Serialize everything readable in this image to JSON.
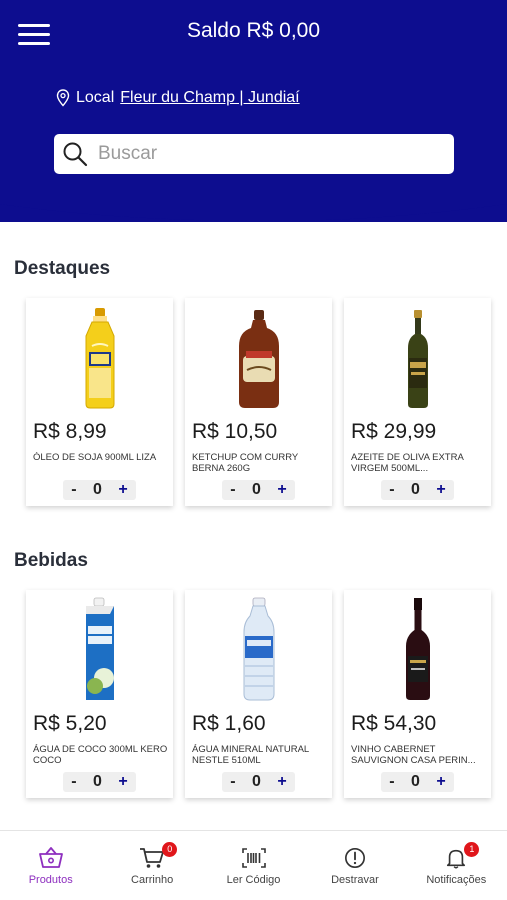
{
  "header": {
    "balance": "Saldo R$ 0,00",
    "location_label": "Local",
    "location_name": "Fleur du Champ | Jundiaí",
    "search_placeholder": "Buscar"
  },
  "sections": [
    {
      "title": "Destaques",
      "products": [
        {
          "price": "R$ 8,99",
          "name": "ÓLEO DE SOJA 900ML LIZA",
          "qty": "0",
          "icon": "oil-bottle-image"
        },
        {
          "price": "R$ 10,50",
          "name": "KETCHUP COM CURRY BERNA 260G",
          "qty": "0",
          "icon": "ketchup-bottle-image"
        },
        {
          "price": "R$ 29,99",
          "name": "AZEITE DE OLIVA EXTRA VIRGEM 500ML...",
          "qty": "0",
          "icon": "olive-oil-bottle-image"
        }
      ]
    },
    {
      "title": "Bebidas",
      "products": [
        {
          "price": "R$ 5,20",
          "name": "ÁGUA DE COCO 300ml KERO COCO",
          "qty": "0",
          "icon": "coconut-water-carton-image"
        },
        {
          "price": "R$ 1,60",
          "name": "ÁGUA MINERAL NATURAL NESTLE 510ml",
          "qty": "0",
          "icon": "water-bottle-image"
        },
        {
          "price": "R$ 54,30",
          "name": "VINHO CABERNET SAUVIGNON CASA PERIN...",
          "qty": "0",
          "icon": "wine-bottle-image"
        }
      ]
    }
  ],
  "qty_controls": {
    "minus": "-",
    "plus": "+"
  },
  "tabbar": {
    "items": [
      {
        "label": "Produtos",
        "icon": "basket-icon",
        "active": true
      },
      {
        "label": "Carrinho",
        "icon": "cart-icon",
        "badge": "0"
      },
      {
        "label": "Ler Código",
        "icon": "barcode-icon"
      },
      {
        "label": "Destravar",
        "icon": "alert-circle-icon"
      },
      {
        "label": "Notificações",
        "icon": "bell-icon",
        "badge": "1"
      }
    ]
  },
  "colors": {
    "header_bg": "#0d0d8f",
    "active_tab": "#8e2fbf",
    "badge": "#e0161b",
    "plus": "#0d0d8f"
  }
}
